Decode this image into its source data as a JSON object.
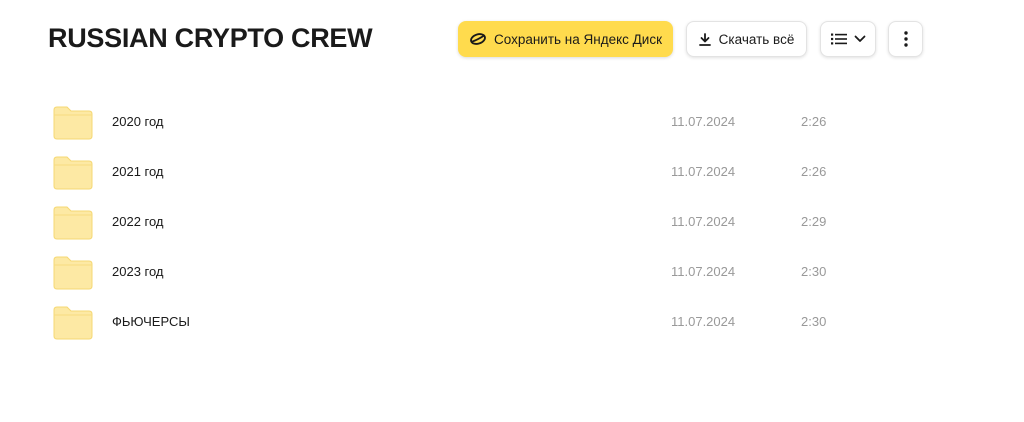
{
  "header": {
    "title": "RUSSIAN CRYPTO CREW"
  },
  "toolbar": {
    "save_label": "Сохранить на Яндекс Диск",
    "save_icon": "disk-icon",
    "download_label": "Скачать всё",
    "download_icon": "download-icon",
    "view_icon": "list-view-icon",
    "view_chevron_icon": "chevron-down-icon",
    "more_icon": "more-vertical-icon"
  },
  "files": [
    {
      "name": "2020 год",
      "date": "11.07.2024",
      "time": "2:26",
      "icon": "folder-icon"
    },
    {
      "name": "2021 год",
      "date": "11.07.2024",
      "time": "2:26",
      "icon": "folder-icon"
    },
    {
      "name": "2022 год",
      "date": "11.07.2024",
      "time": "2:29",
      "icon": "folder-icon"
    },
    {
      "name": "2023 год",
      "date": "11.07.2024",
      "time": "2:30",
      "icon": "folder-icon"
    },
    {
      "name": "ФЬЮЧЕРСЫ",
      "date": "11.07.2024",
      "time": "2:30",
      "icon": "folder-icon"
    }
  ],
  "colors": {
    "accent": "#ffdb4d",
    "folder": "#fde9a4",
    "folder_stroke": "#f5d873",
    "muted_text": "#999999"
  }
}
